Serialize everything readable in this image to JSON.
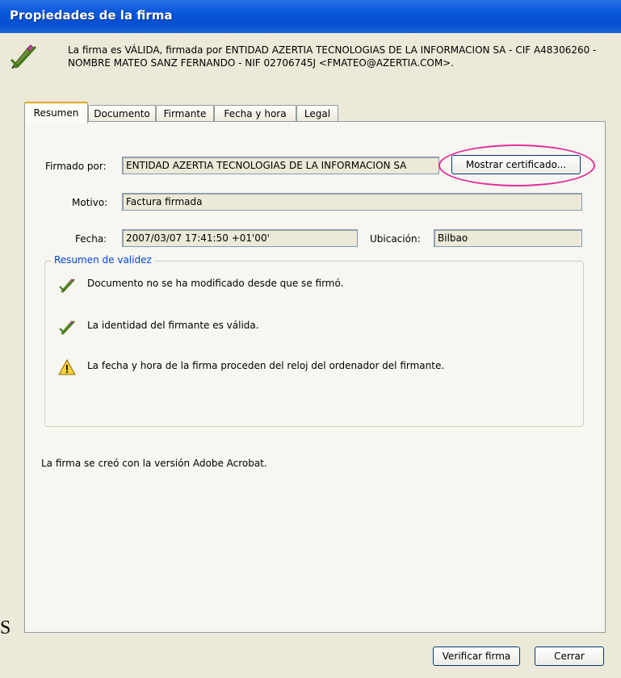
{
  "window": {
    "title": "Propiedades de la firma"
  },
  "header": {
    "icon": "signature-pen-icon",
    "message": "La firma es VÁLIDA, firmada por ENTIDAD AZERTIA TECNOLOGIAS DE LA INFORMACION SA - CIF A48306260 - NOMBRE MATEO SANZ FERNANDO - NIF 02706745J <FMATEO@AZERTIA.COM>."
  },
  "tabs": [
    {
      "label": "Resumen",
      "active": true
    },
    {
      "label": "Documento",
      "active": false
    },
    {
      "label": "Firmante",
      "active": false
    },
    {
      "label": "Fecha y hora",
      "active": false
    },
    {
      "label": "Legal",
      "active": false
    }
  ],
  "summary": {
    "signed_by_label": "Firmado por:",
    "signed_by_value": "ENTIDAD AZERTIA TECNOLOGIAS DE LA INFORMACION SA",
    "show_certificate_button": "Mostrar certificado...",
    "reason_label": "Motivo:",
    "reason_value": "Factura firmada",
    "date_label": "Fecha:",
    "date_value": "2007/03/07 17:41:50 +01'00'",
    "location_label": "Ubicación:",
    "location_value": "Bilbao"
  },
  "validity": {
    "legend": "Resumen de validez",
    "items": [
      {
        "icon": "signature-valid-icon",
        "text": "Documento no se ha modificado desde que se firmó."
      },
      {
        "icon": "signature-valid-icon",
        "text": "La identidad del firmante es válida."
      },
      {
        "icon": "warning-icon",
        "text": "La fecha y hora de la firma proceden del reloj del ordenador del firmante."
      }
    ]
  },
  "footer_text": "La firma se creó con la versión Adobe Acrobat.",
  "buttons": {
    "verify": "Verificar firma",
    "close": "Cerrar"
  },
  "colors": {
    "highlight": "#e0309a",
    "titlebar": "#0a58dc",
    "group_legend": "#0046d5"
  },
  "stray_char": "S"
}
